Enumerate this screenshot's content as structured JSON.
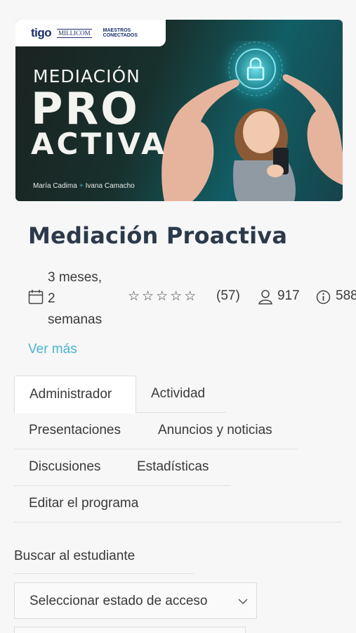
{
  "banner": {
    "logo_tigo": "tigo",
    "logo_millicom": "MILLICOM",
    "logo_maestros_line1": "MAESTROS",
    "logo_maestros_line2": "CONECTADOS",
    "title_line1": "MEDIACIÓN",
    "title_line2": "PRO",
    "title_line3": "ACTIVA",
    "author1": "María Cadima",
    "author2": "Ivana Camacho"
  },
  "course": {
    "title": "Mediación Proactiva",
    "duration_line1": "3 meses,",
    "duration_line2": "2",
    "duration_line3": "semanas",
    "rating_count": "(57)",
    "students": "917",
    "info_value": "588",
    "ver_mas": "Ver más"
  },
  "tabs": {
    "administrador": "Administrador",
    "actividad": "Actividad",
    "presentaciones": "Presentaciones",
    "anuncios": "Anuncios y noticias",
    "discusiones": "Discusiones",
    "estadisticas": "Estadísticas",
    "editar": "Editar el programa"
  },
  "search": {
    "label": "Buscar al estudiante",
    "select_value": "Seleccionar estado de acceso"
  },
  "icons": [
    "calendar-icon",
    "star-outline-icon",
    "user-icon",
    "info-icon",
    "chevron-down-icon",
    "lock-icon"
  ],
  "colors": {
    "link": "#4ab4d0",
    "title": "#2c3a4a",
    "banner_teal": "#125e66"
  }
}
